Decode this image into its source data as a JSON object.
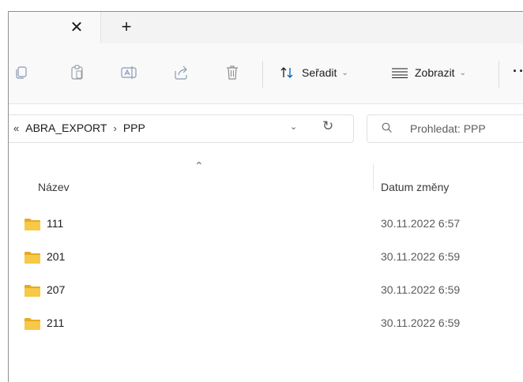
{
  "tabs": {
    "close_glyph": "✕",
    "new_tab_glyph": "+"
  },
  "toolbar": {
    "icons": [
      "copy-icon",
      "paste-icon",
      "rename-icon",
      "share-icon",
      "delete-icon"
    ],
    "sort_label": "Seřadit",
    "view_label": "Zobrazit",
    "more_glyph": "··",
    "caret": "⌄"
  },
  "address": {
    "overflow_glyph": "«",
    "crumbs": [
      "ABRA_EXPORT",
      "PPP"
    ],
    "separator": "›",
    "dropdown_glyph": "⌄",
    "refresh_glyph": "↻"
  },
  "search": {
    "placeholder": "Prohledat: PPP"
  },
  "columns": {
    "name": "Název",
    "date": "Datum změny",
    "sort_indicator": "⌃"
  },
  "rows": [
    {
      "name": "111",
      "date": "30.11.2022 6:57"
    },
    {
      "name": "201",
      "date": "30.11.2022 6:59"
    },
    {
      "name": "207",
      "date": "30.11.2022 6:59"
    },
    {
      "name": "211",
      "date": "30.11.2022 6:59"
    }
  ],
  "colors": {
    "folder": "#f5c542",
    "accent": "#005fb8"
  }
}
